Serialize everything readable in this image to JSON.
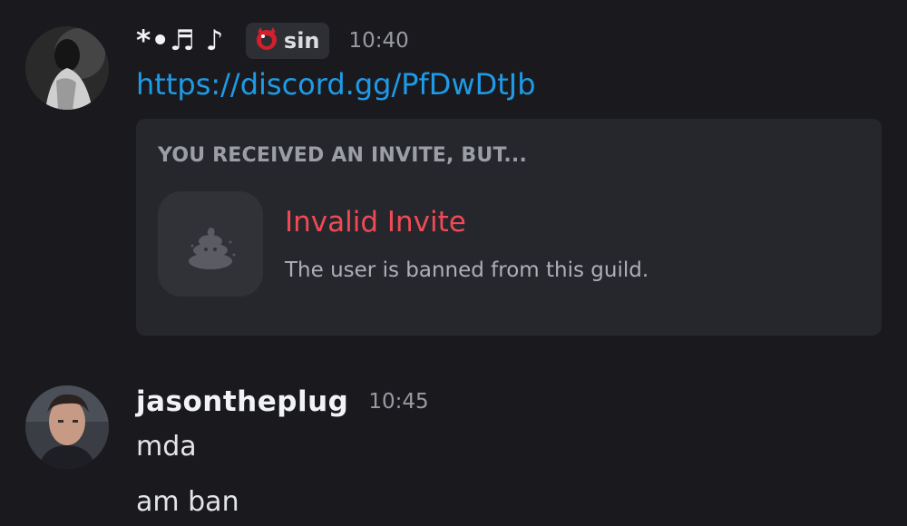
{
  "messages": [
    {
      "author": "*•♬ ♪",
      "tag": {
        "icon": "red-demon-ring-icon",
        "text": "sin"
      },
      "time": "10:40",
      "link": "https://discord.gg/PfDwDtJb",
      "embed": {
        "heading": "YOU RECEIVED AN INVITE, BUT...",
        "icon": "poop-icon",
        "title": "Invalid Invite",
        "description": "The user is banned from this guild."
      }
    },
    {
      "author": "jasontheplug",
      "time": "10:45",
      "lines": [
        "mda",
        "am ban"
      ]
    }
  ],
  "colors": {
    "background": "#1a1a1e",
    "embed": "#26272c",
    "link": "#1e9be8",
    "invalid": "#ef4a55",
    "timestamp": "#9a9ba2"
  }
}
